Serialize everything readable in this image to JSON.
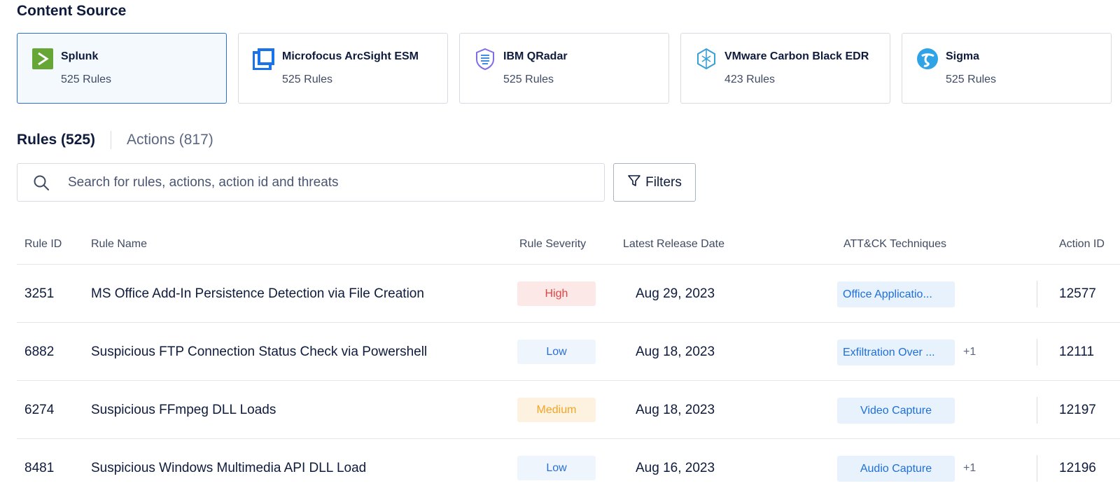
{
  "content_source": {
    "title": "Content Source",
    "sources": [
      {
        "name": "Splunk",
        "count": "525 Rules",
        "icon": "splunk-icon",
        "selected": true
      },
      {
        "name": "Microfocus ArcSight ESM",
        "count": "525 Rules",
        "icon": "arcsight-icon",
        "selected": false
      },
      {
        "name": "IBM QRadar",
        "count": "525 Rules",
        "icon": "qradar-icon",
        "selected": false
      },
      {
        "name": "VMware Carbon Black EDR",
        "count": "423 Rules",
        "icon": "carbon-black-icon",
        "selected": false
      },
      {
        "name": "Sigma",
        "count": "525 Rules",
        "icon": "sigma-icon",
        "selected": false
      }
    ]
  },
  "tabs": {
    "rules": "Rules (525)",
    "actions": "Actions (817)"
  },
  "search": {
    "placeholder": "Search for rules, actions, action id and threats",
    "icon": "search-icon"
  },
  "filters": {
    "label": "Filters",
    "icon": "filter-icon"
  },
  "table": {
    "headers": {
      "rule_id": "Rule ID",
      "rule_name": "Rule Name",
      "severity": "Rule Severity",
      "release_date": "Latest Release Date",
      "techniques": "ATT&CK Techniques",
      "action_id": "Action ID"
    },
    "rows": [
      {
        "id": "3251",
        "name": "MS Office Add-In Persistence Detection via File Creation",
        "severity": "High",
        "date": "Aug 29, 2023",
        "technique": "Office Applicatio...",
        "more": "",
        "action_id": "12577"
      },
      {
        "id": "6882",
        "name": "Suspicious FTP Connection Status Check via Powershell",
        "severity": "Low",
        "date": "Aug 18, 2023",
        "technique": "Exfiltration Over ...",
        "more": "+1",
        "action_id": "12111"
      },
      {
        "id": "6274",
        "name": "Suspicious FFmpeg DLL Loads",
        "severity": "Medium",
        "date": "Aug 18, 2023",
        "technique": "Video Capture",
        "more": "",
        "action_id": "12197"
      },
      {
        "id": "8481",
        "name": "Suspicious Windows Multimedia API DLL Load",
        "severity": "Low",
        "date": "Aug 16, 2023",
        "technique": "Audio Capture",
        "more": "+1",
        "action_id": "12196"
      }
    ]
  },
  "colors": {
    "accent": "#2b6fd6",
    "high": "#e04444",
    "medium": "#f5a524",
    "low": "#2b6fd6",
    "splunk_green": "#65a637"
  }
}
